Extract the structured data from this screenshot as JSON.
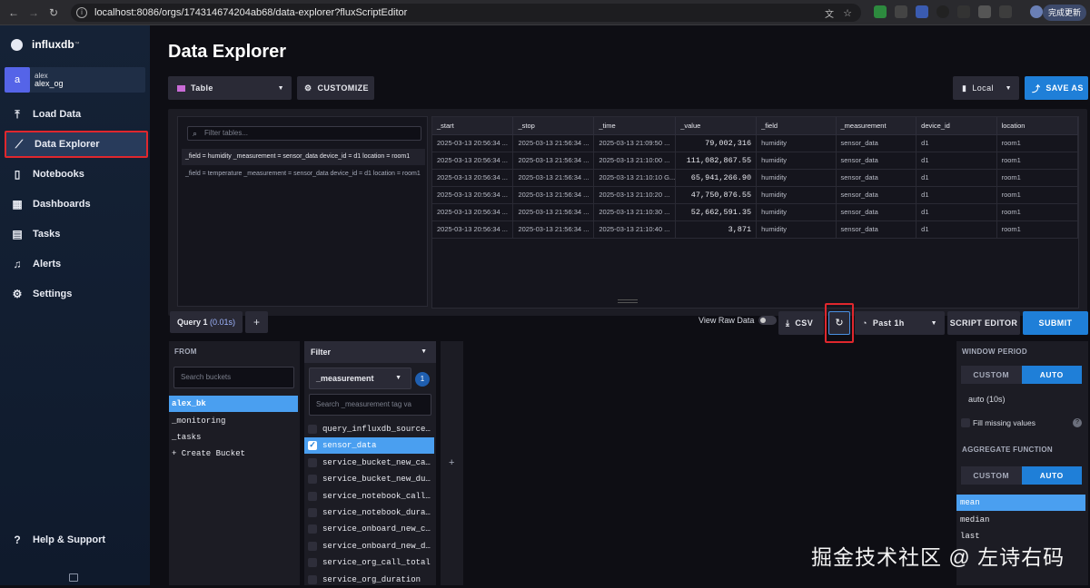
{
  "browser": {
    "url": "localhost:8086/orgs/174314674204ab68/data-explorer?fluxScriptEditor",
    "update_label": "完成更新"
  },
  "sidebar": {
    "logo": "influxdb",
    "logo_sup": "™",
    "user": {
      "avatar": "a",
      "name": "alex",
      "org": "alex_og"
    },
    "items": [
      {
        "label": "Load Data",
        "icon": "upload-icon"
      },
      {
        "label": "Data Explorer",
        "icon": "chart-icon"
      },
      {
        "label": "Notebooks",
        "icon": "notebook-icon"
      },
      {
        "label": "Dashboards",
        "icon": "dashboard-icon"
      },
      {
        "label": "Tasks",
        "icon": "calendar-icon"
      },
      {
        "label": "Alerts",
        "icon": "bell-icon"
      },
      {
        "label": "Settings",
        "icon": "gear-icon"
      }
    ],
    "help": "Help & Support"
  },
  "header": {
    "title": "Data Explorer",
    "vis_type": "Table",
    "customize": "CUSTOMIZE",
    "timezone": "Local",
    "save_as": "SAVE AS"
  },
  "tables": {
    "filter_placeholder": "Filter tables...",
    "items": [
      "_field = humidity _measurement = sensor_data device_id = d1 location = room1",
      "_field = temperature _measurement = sensor_data device_id = d1 location = room1"
    ]
  },
  "grid": {
    "columns": [
      "_start",
      "_stop",
      "_time",
      "_value",
      "_field",
      "_measurement",
      "device_id",
      "location"
    ],
    "rows": [
      [
        "2025-03-13 20:56:34 ...",
        "2025-03-13 21:56:34 ...",
        "2025-03-13 21:09:50 ...",
        "79,002,316",
        "humidity",
        "sensor_data",
        "d1",
        "room1"
      ],
      [
        "2025-03-13 20:56:34 ...",
        "2025-03-13 21:56:34 ...",
        "2025-03-13 21:10:00 ...",
        "111,082,867.55",
        "humidity",
        "sensor_data",
        "d1",
        "room1"
      ],
      [
        "2025-03-13 20:56:34 ...",
        "2025-03-13 21:56:34 ...",
        "2025-03-13 21:10:10 G...",
        "65,941,266.90",
        "humidity",
        "sensor_data",
        "d1",
        "room1"
      ],
      [
        "2025-03-13 20:56:34 ...",
        "2025-03-13 21:56:34 ...",
        "2025-03-13 21:10:20 ...",
        "47,750,876.55",
        "humidity",
        "sensor_data",
        "d1",
        "room1"
      ],
      [
        "2025-03-13 20:56:34 ...",
        "2025-03-13 21:56:34 ...",
        "2025-03-13 21:10:30 ...",
        "52,662,591.35",
        "humidity",
        "sensor_data",
        "d1",
        "room1"
      ],
      [
        "2025-03-13 20:56:34 ...",
        "2025-03-13 21:56:34 ...",
        "2025-03-13 21:10:40 ...",
        "3,871",
        "humidity",
        "sensor_data",
        "d1",
        "room1"
      ]
    ]
  },
  "query": {
    "tab_label": "Query 1",
    "tab_time": "(0.01s)",
    "add": "+",
    "view_raw": "View Raw Data",
    "csv": "CSV",
    "time_range": "Past 1h",
    "script_editor": "SCRIPT EDITOR",
    "submit": "SUBMIT"
  },
  "from": {
    "header": "FROM",
    "search_placeholder": "Search buckets",
    "buckets": [
      "alex_bk",
      "_monitoring",
      "_tasks",
      "+ Create Bucket"
    ],
    "selected": "alex_bk"
  },
  "filter": {
    "header": "Filter",
    "key": "_measurement",
    "count": "1",
    "search_placeholder": "Search _measurement tag va",
    "values": [
      "query_influxdb_source…",
      "sensor_data",
      "service_bucket_new_ca…",
      "service_bucket_new_du…",
      "service_notebook_call…",
      "service_notebook_dura…",
      "service_onboard_new_c…",
      "service_onboard_new_d…",
      "service_org_call_total",
      "service_org_duration"
    ],
    "selected": "sensor_data",
    "add": "+"
  },
  "window": {
    "period_header": "WINDOW PERIOD",
    "custom": "CUSTOM",
    "auto": "AUTO",
    "period_value": "auto (10s)",
    "fill_missing": "Fill missing values",
    "help": "?",
    "agg_header": "AGGREGATE FUNCTION",
    "functions": [
      "mean",
      "median",
      "last"
    ],
    "selected_fn": "mean"
  },
  "watermark": "掘金技术社区 @ 左诗右码"
}
